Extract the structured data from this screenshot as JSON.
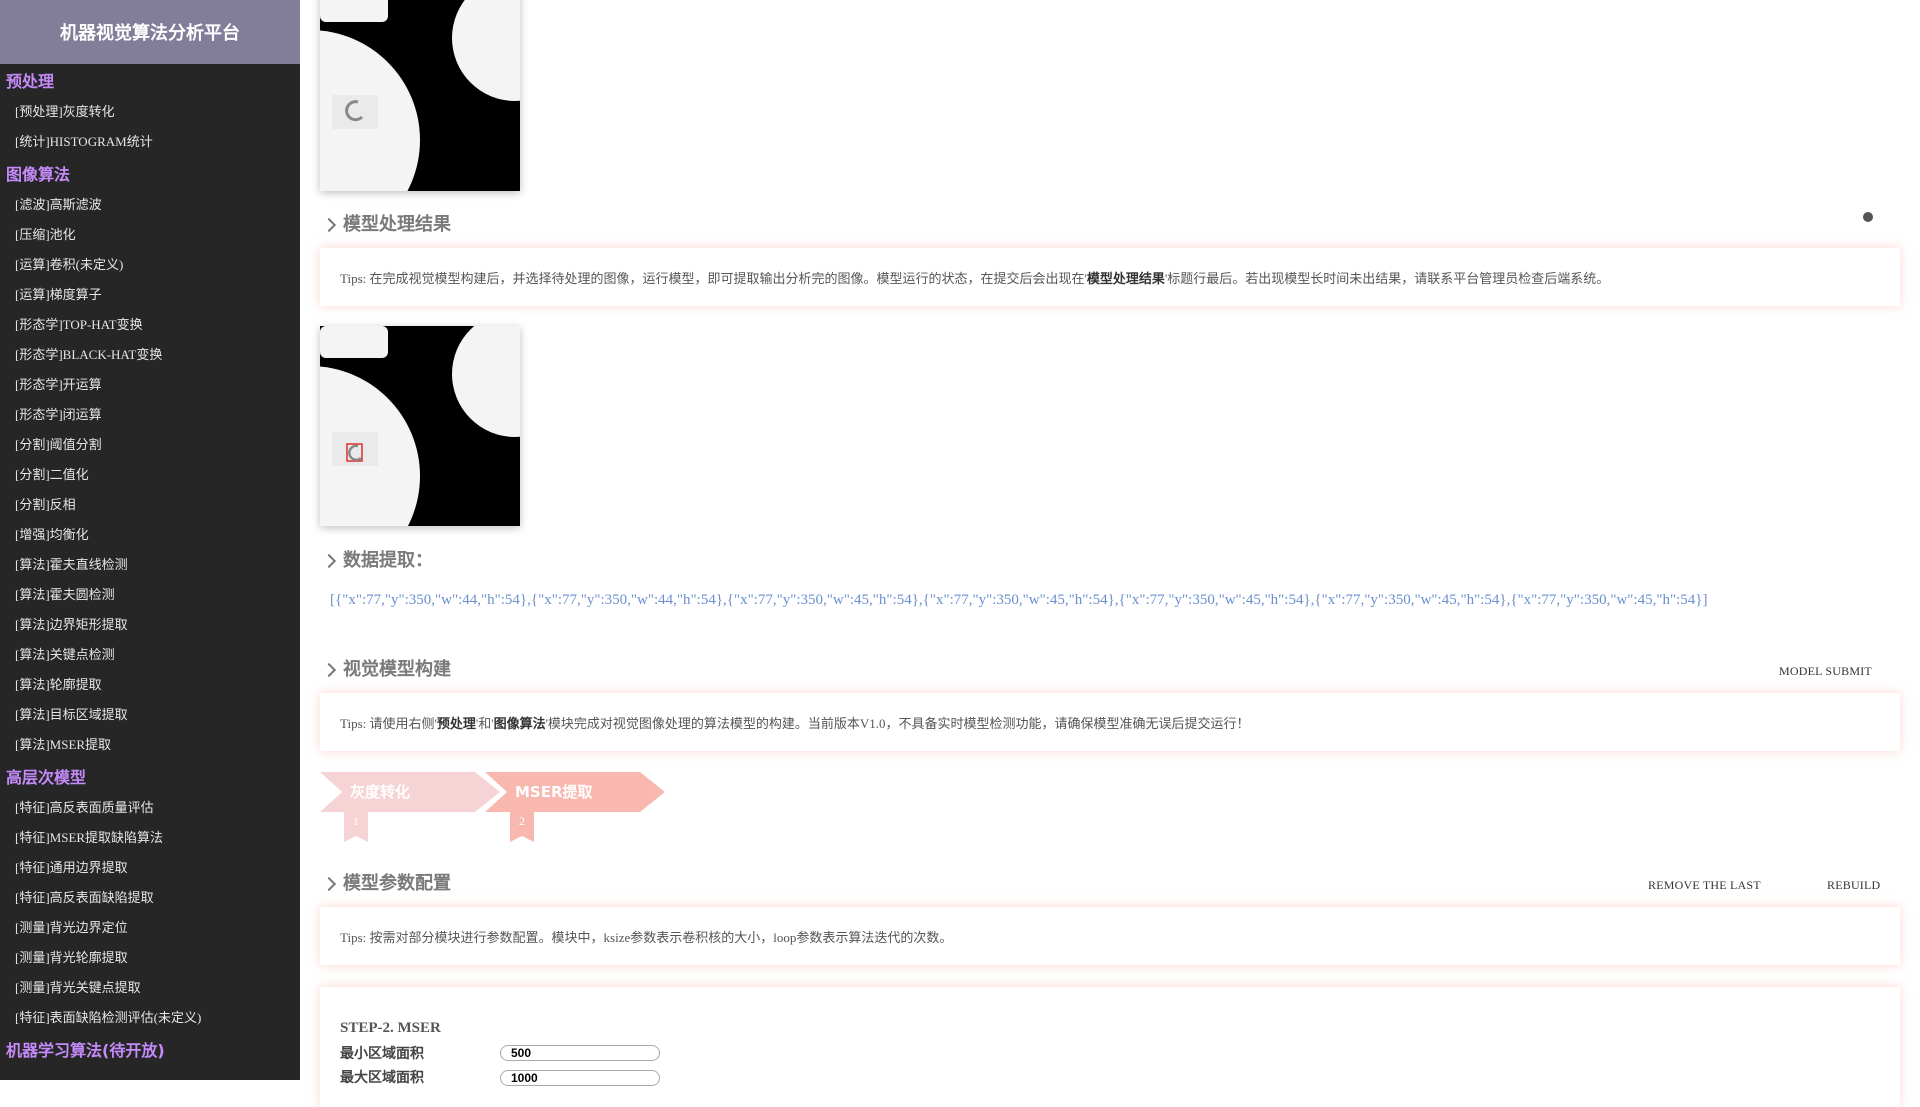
{
  "app": {
    "title": "机器视觉算法分析平台"
  },
  "sidebar": {
    "groups": [
      {
        "title": "预处理",
        "items": [
          "[预处理]灰度转化",
          "[统计]HISTOGRAM统计"
        ]
      },
      {
        "title": "图像算法",
        "items": [
          "[滤波]高斯滤波",
          "[压缩]池化",
          "[运算]卷积(未定义)",
          "[运算]梯度算子",
          "[形态学]TOP-HAT变换",
          "[形态学]BLACK-HAT变换",
          "[形态学]开运算",
          "[形态学]闭运算",
          "[分割]阈值分割",
          "[分割]二值化",
          "[分割]反相",
          "[增强]均衡化",
          "[算法]霍夫直线检测",
          "[算法]霍夫圆检测",
          "[算法]边界矩形提取",
          "[算法]关键点检测",
          "[算法]轮廓提取",
          "[算法]目标区域提取",
          "[算法]MSER提取"
        ]
      },
      {
        "title": "高层次模型",
        "items": [
          "[特征]高反表面质量评估",
          "[特征]MSER提取缺陷算法",
          "[特征]通用边界提取",
          "[特征]高反表面缺陷提取",
          "[测量]背光边界定位",
          "[测量]背光轮廓提取",
          "[测量]背光关键点提取",
          "[特征]表面缺陷检测评估(未定义)"
        ]
      },
      {
        "title": "机器学习算法(待开放)",
        "items": []
      }
    ]
  },
  "result_section": {
    "title": "模型处理结果",
    "tips_prefix": "Tips: 在完成视觉模型构建后，并选择待处理的图像，运行模型，即可提取输出分析完的图像。模型运行的状态，在提交后会出现在'",
    "tips_bold": "模型处理结果",
    "tips_suffix": "'标题行最后。若出现模型长时间未出结果，请联系平台管理员检查后端系统。"
  },
  "data_section": {
    "title": "数据提取：",
    "output": "[{\"x\":77,\"y\":350,\"w\":44,\"h\":54},{\"x\":77,\"y\":350,\"w\":44,\"h\":54},{\"x\":77,\"y\":350,\"w\":45,\"h\":54},{\"x\":77,\"y\":350,\"w\":45,\"h\":54},{\"x\":77,\"y\":350,\"w\":45,\"h\":54},{\"x\":77,\"y\":350,\"w\":45,\"h\":54},{\"x\":77,\"y\":350,\"w\":45,\"h\":54}]"
  },
  "build_section": {
    "title": "视觉模型构建",
    "submit_label": "MODEL SUBMIT",
    "tips_prefix": "Tips: 请使用右侧'",
    "tips_bold1": "预处理",
    "tips_mid": "'和'",
    "tips_bold2": "图像算法",
    "tips_suffix": "'模块完成对视觉图像处理的算法模型的构建。当前版本V1.0，不具备实时模型检测功能，请确保模型准确无误后提交运行！",
    "steps": [
      {
        "label": "灰度转化",
        "number": "1",
        "color": "#f6d3d5"
      },
      {
        "label": "MSER提取",
        "number": "2",
        "color": "#f8b8b0"
      }
    ]
  },
  "config_section": {
    "title": "模型参数配置",
    "remove_label": "REMOVE THE LAST",
    "rebuild_label": "REBUILD",
    "tips": "Tips: 按需对部分模块进行参数配置。模块中，ksize参数表示卷积核的大小，loop参数表示算法迭代的次数。",
    "step_heading": "STEP-2. MSER",
    "params": [
      {
        "label": "最小区域面积",
        "value": "500"
      },
      {
        "label": "最大区域面积",
        "value": "1000"
      }
    ]
  },
  "colors": {
    "brand_bg": "#827d99",
    "sidebar_bg": "#262626",
    "group_title": "#c58af9",
    "json_text": "#6b8fd0"
  }
}
